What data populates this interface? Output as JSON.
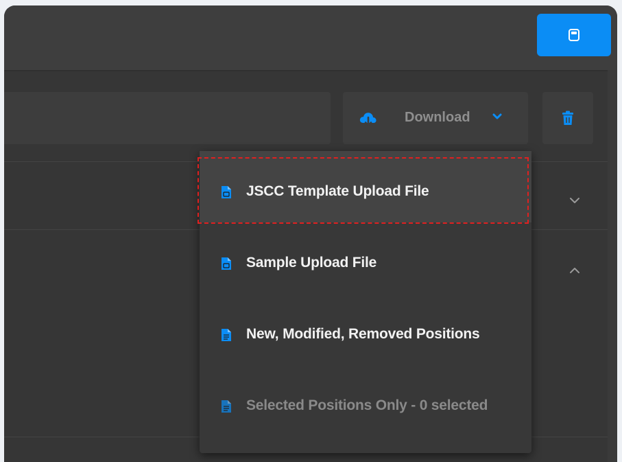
{
  "toolbar": {
    "download_label": "Download",
    "search_value": ""
  },
  "menu": {
    "items": [
      {
        "label": "JSCC Template Upload File",
        "icon": "document-icon",
        "highlighted": true,
        "disabled": false
      },
      {
        "label": "Sample Upload File",
        "icon": "document-icon",
        "highlighted": false,
        "disabled": false
      },
      {
        "label": "New, Modified, Removed Positions",
        "icon": "document-icon",
        "highlighted": false,
        "disabled": false
      },
      {
        "label": "Selected Positions Only - 0 selected",
        "icon": "document-icon",
        "highlighted": false,
        "disabled": true
      }
    ]
  },
  "icons": {
    "top_button": "calculator-icon",
    "download": "cloud-download-icon",
    "download_chevron": "chevron-down-icon",
    "delete": "trash-icon",
    "row1": "chevron-down-icon",
    "row2": "chevron-up-icon"
  },
  "colors": {
    "accent": "#0b8df5",
    "focus_outline": "#e02020",
    "panel_bg": "#363636",
    "menu_bg": "#383838"
  }
}
